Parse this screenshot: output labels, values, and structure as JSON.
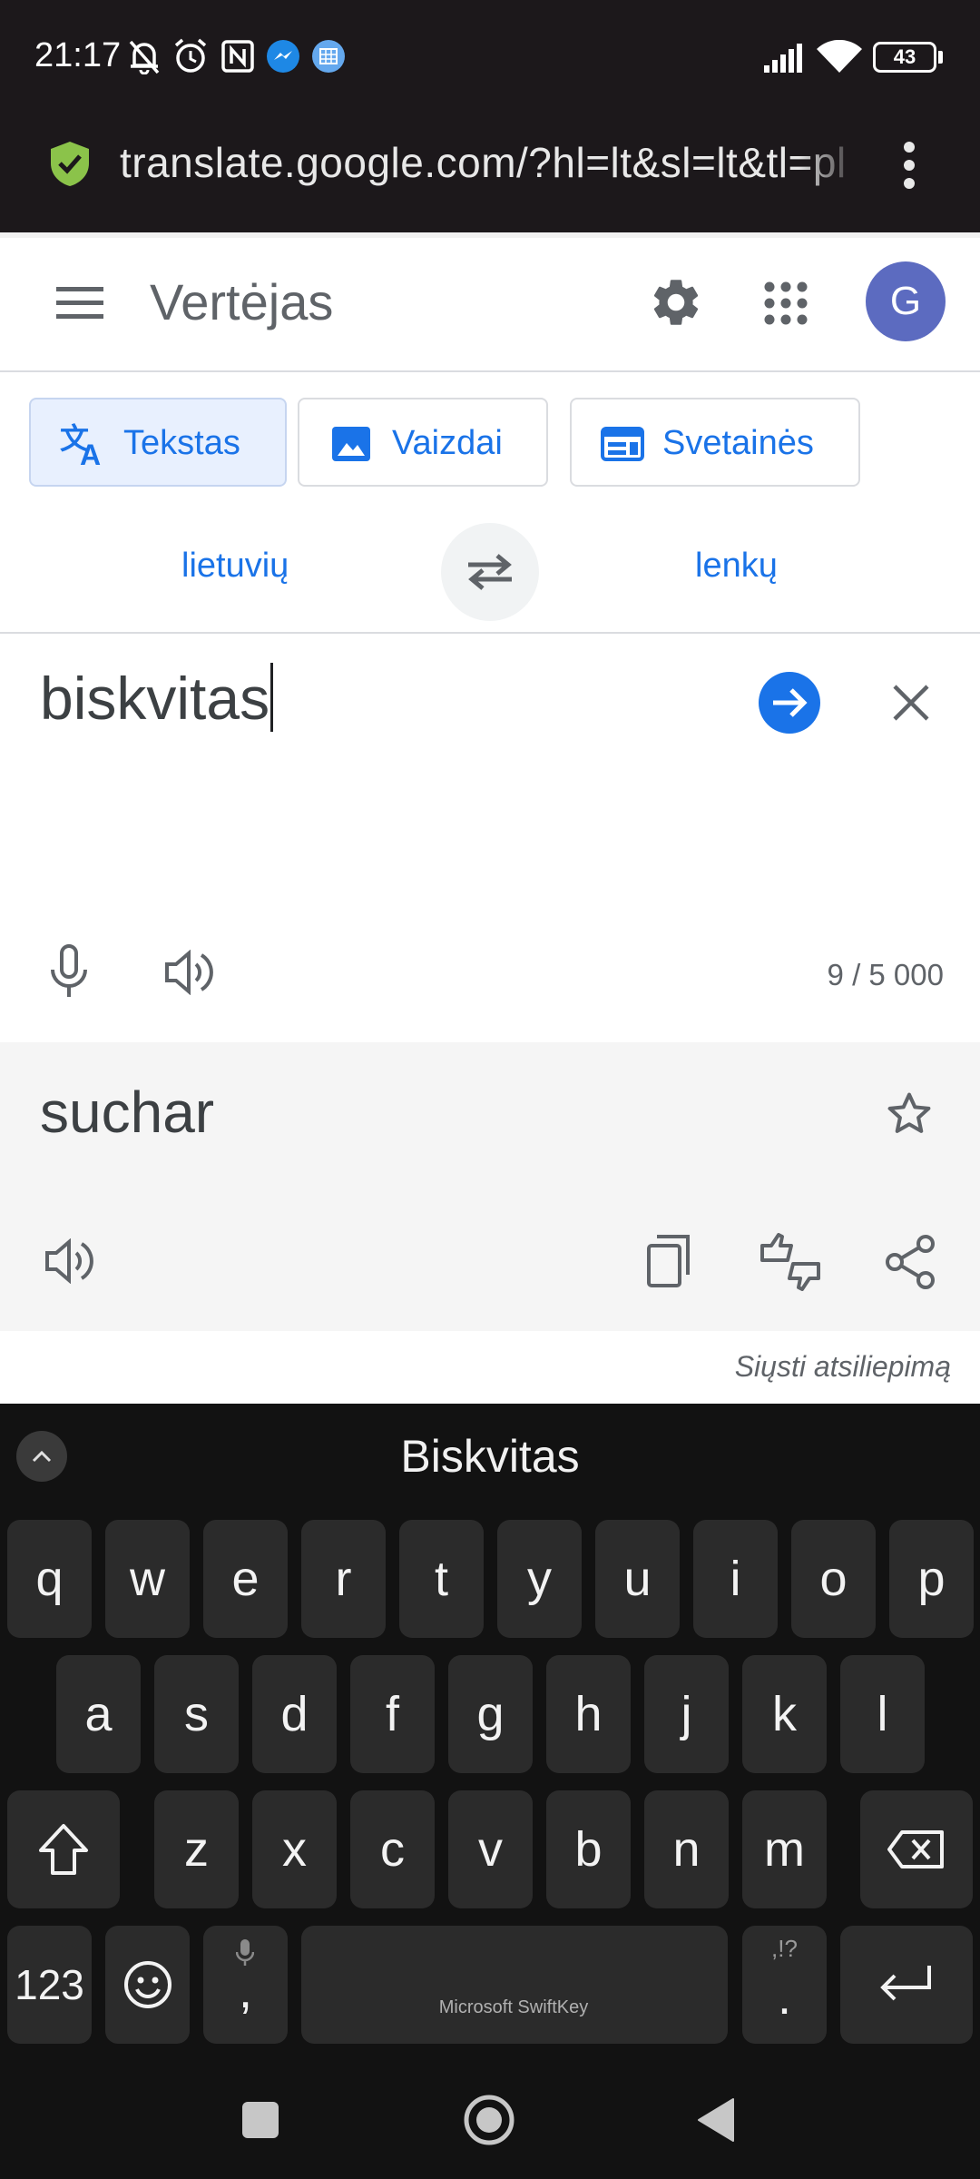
{
  "status_bar": {
    "time": "21:17",
    "battery": "43",
    "icons": [
      "bell-off-icon",
      "alarm-icon",
      "nfc-icon",
      "messenger-icon",
      "app-icon",
      "signal-icon",
      "wifi-icon",
      "battery-icon"
    ]
  },
  "browser": {
    "url": "translate.google.com/?hl=lt&sl=lt&tl=pl",
    "icons": [
      "shield-check-icon",
      "more-vert-icon"
    ]
  },
  "header": {
    "title": "Vertėjas",
    "avatar_letter": "G",
    "icons": [
      "menu-icon",
      "settings-icon",
      "apps-icon"
    ]
  },
  "modes": {
    "text": "Tekstas",
    "images": "Vaizdai",
    "websites": "Svetainės",
    "active": "text"
  },
  "languages": {
    "source": "lietuvių",
    "target": "lenkų"
  },
  "source": {
    "text": "biskvitas",
    "char_count": "9 / 5 000"
  },
  "result": {
    "text": "suchar",
    "feedback": "Siųsti atsiliepimą"
  },
  "keyboard": {
    "suggestion": "Biskvitas",
    "row1": [
      "q",
      "w",
      "e",
      "r",
      "t",
      "y",
      "u",
      "i",
      "o",
      "p"
    ],
    "row2": [
      "a",
      "s",
      "d",
      "f",
      "g",
      "h",
      "j",
      "k",
      "l"
    ],
    "row3": [
      "z",
      "x",
      "c",
      "v",
      "b",
      "n",
      "m"
    ],
    "numbers_key": "123",
    "comma_key": ",",
    "period_key": ".",
    "period_hint": ",!?",
    "space_label": "Microsoft SwiftKey"
  },
  "colors": {
    "accent": "#1a73e8",
    "avatar": "#5c6bc0",
    "status_bar": "#1c181b",
    "keyboard_bg": "#121212",
    "key_bg": "#2b2b2b",
    "shield": "#8bc34a"
  }
}
